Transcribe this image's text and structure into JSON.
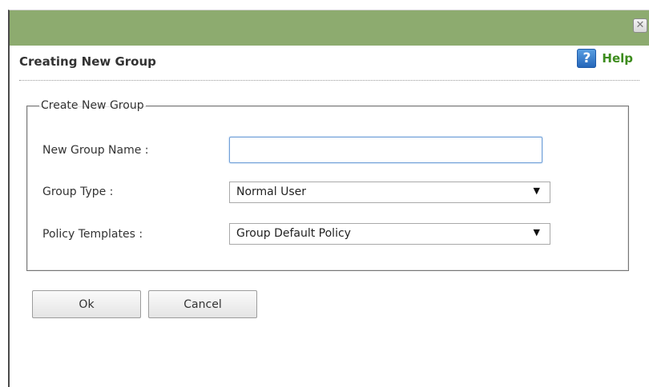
{
  "dialog": {
    "close_symbol": "✕",
    "heading": "Creating New Group",
    "help": {
      "icon_symbol": "?",
      "label": "Help"
    }
  },
  "form": {
    "legend": "Create New Group",
    "name_label": "New Group Name :",
    "name_value": "",
    "group_type": {
      "label": "Group Type :",
      "selected": "Normal User"
    },
    "policy_templates": {
      "label": "Policy Templates :",
      "selected": "Group Default Policy"
    },
    "dropdown_arrow": "▼"
  },
  "buttons": {
    "ok": "Ok",
    "cancel": "Cancel"
  },
  "colors": {
    "titlebar": "#8dab6f",
    "help_text": "#3d8c1d",
    "help_icon": "#2f78cc",
    "input_focus_border": "#6f9fd8"
  },
  "icons": {
    "close": "close-icon",
    "help": "help-question-icon",
    "dropdown": "chevron-down-icon"
  }
}
